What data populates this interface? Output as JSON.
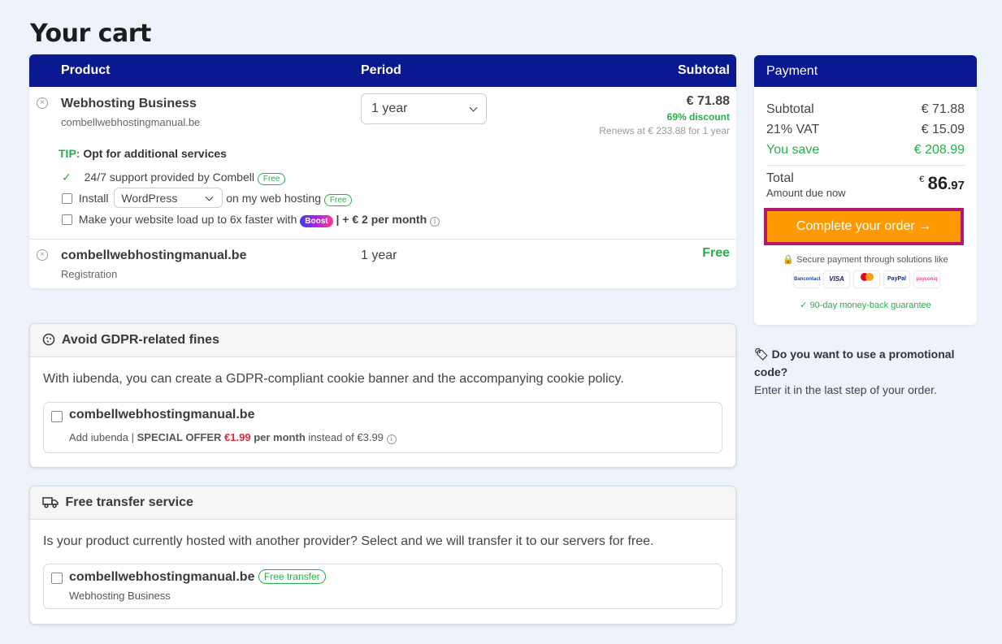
{
  "page": {
    "title": "Your cart"
  },
  "cart": {
    "headers": {
      "product": "Product",
      "period": "Period",
      "subtotal": "Subtotal"
    },
    "item1": {
      "name": "Webhosting Business",
      "domain": "combellwebhostingmanual.be",
      "period": "1 year",
      "price": "€ 71.88",
      "discount": "69% discount",
      "renews": "Renews at € 233.88 for 1 year"
    },
    "tip": {
      "label": "TIP:",
      "text": "Opt for additional services"
    },
    "services": {
      "support": "24/7 support provided by Combell",
      "support_badge": "Free",
      "install": "Install",
      "install_select": "WordPress",
      "install_suffix": "on my web hosting",
      "install_badge": "Free",
      "boost_text": "Make your website load up to 6x faster with",
      "boost_badge": "Boost",
      "boost_price": "| + € 2 per month"
    },
    "item2": {
      "name": "combellwebhostingmanual.be",
      "sub": "Registration",
      "period": "1 year",
      "price": "Free"
    }
  },
  "payment": {
    "title": "Payment",
    "subtotal_label": "Subtotal",
    "subtotal": "€ 71.88",
    "vat_label": "21% VAT",
    "vat": "€ 15.09",
    "save_label": "You save",
    "save": "€ 208.99",
    "total_label": "Total",
    "amount_due": "Amount due now",
    "total_currency": "€",
    "total_int": "86",
    "total_dec": ".97",
    "order_button": "Complete your order →",
    "secure": "Secure payment through solutions like",
    "logos": [
      "Bancontact",
      "VISA",
      "Mastercard",
      "PayPal",
      "payconiq"
    ],
    "guarantee": "90-day money-back guarantee",
    "colors": {
      "header": "#0a1891",
      "button": "#ff9900",
      "green": "#25b04a"
    }
  },
  "promo": {
    "question": "Do you want to use a promotional code?",
    "hint": "Enter it in the last step of your order."
  },
  "gdpr": {
    "title": "Avoid GDPR-related fines",
    "text": "With iubenda, you can create a GDPR-compliant cookie banner and the accompanying cookie policy.",
    "domain": "combellwebhostingmanual.be",
    "add": "Add iubenda |",
    "special": "SPECIAL OFFER",
    "price": "€1.99",
    "per": "per month",
    "instead": "instead of €3.99"
  },
  "transfer": {
    "title": "Free transfer service",
    "text": "Is your product currently hosted with another provider? Select and we will transfer it to our servers for free.",
    "domain": "combellwebhostingmanual.be",
    "badge": "Free transfer",
    "sub": "Webhosting Business"
  }
}
